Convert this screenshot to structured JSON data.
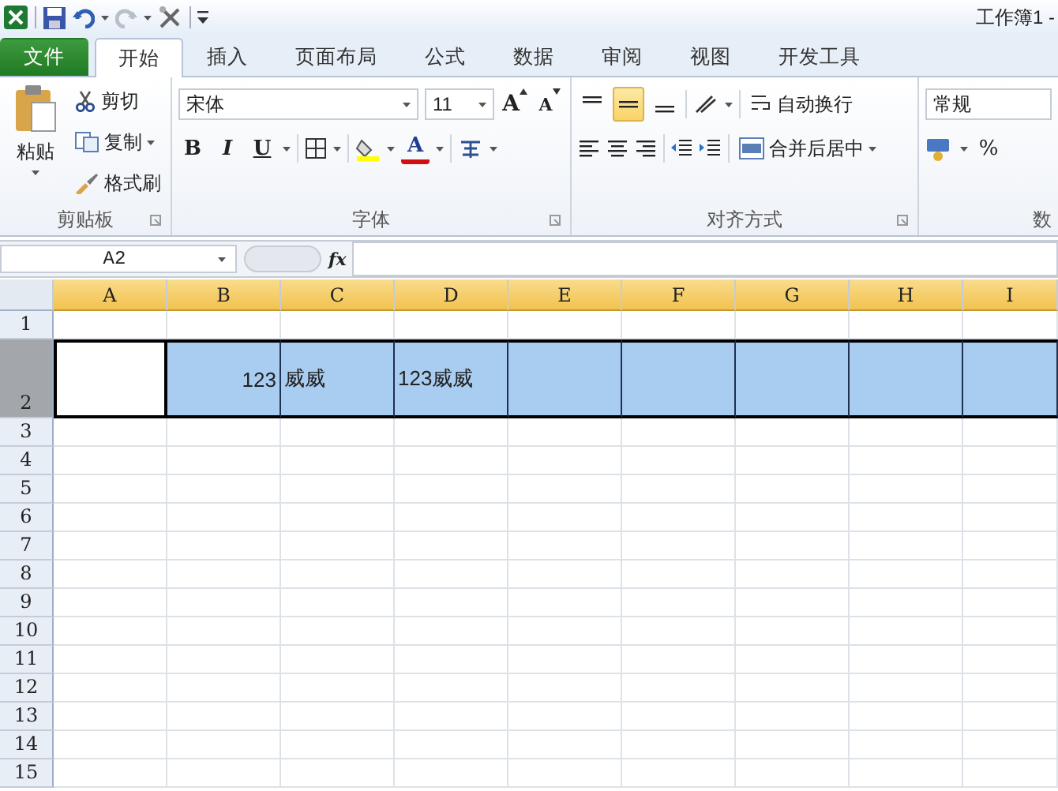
{
  "window": {
    "title": "工作簿1 -"
  },
  "tabs": [
    {
      "label": "文件",
      "kind": "file",
      "selected": false
    },
    {
      "label": "开始",
      "kind": "tab",
      "selected": true
    },
    {
      "label": "插入",
      "kind": "tab",
      "selected": false
    },
    {
      "label": "页面布局",
      "kind": "tab",
      "selected": false
    },
    {
      "label": "公式",
      "kind": "tab",
      "selected": false
    },
    {
      "label": "数据",
      "kind": "tab",
      "selected": false
    },
    {
      "label": "审阅",
      "kind": "tab",
      "selected": false
    },
    {
      "label": "视图",
      "kind": "tab",
      "selected": false
    },
    {
      "label": "开发工具",
      "kind": "tab",
      "selected": false
    }
  ],
  "ribbon": {
    "clipboard": {
      "paste": "粘贴",
      "cut": "剪切",
      "copy": "复制",
      "format_painter": "格式刷",
      "label": "剪贴板"
    },
    "font": {
      "name": "宋体",
      "size": "11",
      "grow": "A",
      "shrink": "A",
      "bold": "B",
      "italic": "I",
      "underline": "U",
      "font_color": "A",
      "label": "字体"
    },
    "alignment": {
      "vertical": [
        {
          "kind": "top",
          "selected": false
        },
        {
          "kind": "middle",
          "selected": true
        },
        {
          "kind": "bottom",
          "selected": false
        }
      ],
      "wrap": "自动换行",
      "merge": "合并后居中",
      "label": "对齐方式"
    },
    "number": {
      "format": "常规",
      "percent": "%",
      "label": "数"
    }
  },
  "formula_bar": {
    "name_box": "A2",
    "function_button": "fx"
  },
  "sheet": {
    "columns": [
      {
        "label": "A",
        "selected": true
      },
      {
        "label": "B",
        "selected": true
      },
      {
        "label": "C",
        "selected": true
      },
      {
        "label": "D",
        "selected": true
      },
      {
        "label": "E",
        "selected": true
      },
      {
        "label": "F",
        "selected": true
      },
      {
        "label": "G",
        "selected": true
      },
      {
        "label": "H",
        "selected": true
      },
      {
        "label": "I",
        "selected": true
      }
    ],
    "rows": [
      {
        "header": "1",
        "selected": false
      },
      {
        "header": "2",
        "selected": true,
        "cells": [
          {
            "active": true
          },
          {
            "value": "123",
            "kind": "number"
          },
          {
            "value": "威威",
            "kind": "text"
          },
          {
            "value": "123威威",
            "kind": "text"
          },
          {},
          {},
          {},
          {},
          {}
        ]
      },
      {
        "header": "3",
        "selected": false
      },
      {
        "header": "4",
        "selected": false
      },
      {
        "header": "5",
        "selected": false
      },
      {
        "header": "6",
        "selected": false
      },
      {
        "header": "7",
        "selected": false
      },
      {
        "header": "8",
        "selected": false
      },
      {
        "header": "9",
        "selected": false
      },
      {
        "header": "10",
        "selected": false
      },
      {
        "header": "11",
        "selected": false
      },
      {
        "header": "12",
        "selected": false
      },
      {
        "header": "13",
        "selected": false
      },
      {
        "header": "14",
        "selected": false
      },
      {
        "header": "15",
        "selected": false
      }
    ]
  }
}
